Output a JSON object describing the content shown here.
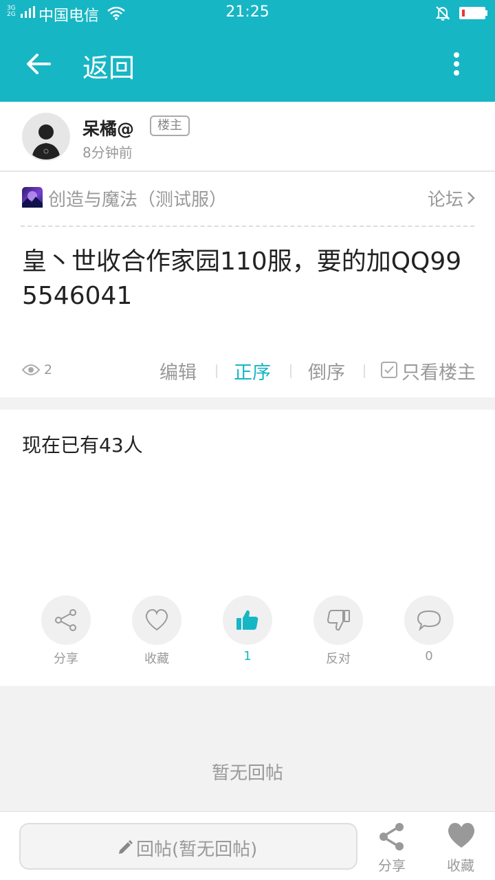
{
  "status_bar": {
    "net_top": "3G",
    "net_bottom": "2G",
    "carrier": "中国电信",
    "time": "21:25",
    "battery_level": 0.12
  },
  "app_bar": {
    "back_label": "返回"
  },
  "post": {
    "author": "呆橘@",
    "owner_badge": "楼主",
    "time_ago": "8分钟前",
    "forum_name": "创造与魔法（测试服）",
    "forum_link": "论坛",
    "title": "皇丶世收合作家园110服，要的加QQ995546041",
    "views": "2",
    "actions": {
      "edit": "编辑",
      "asc": "正序",
      "desc": "倒序",
      "owner_only": "只看楼主"
    },
    "content": "现在已有43人"
  },
  "reactions": {
    "share": "分享",
    "favorite": "收藏",
    "like_count": "1",
    "oppose": "反对",
    "comment_count": "0"
  },
  "replies": {
    "empty_text": "暂无回帖"
  },
  "bottom_bar": {
    "reply_label": "回帖(暂无回帖)",
    "share_label": "分享",
    "favorite_label": "收藏"
  },
  "colors": {
    "accent": "#17b6c4",
    "text_primary": "#222222",
    "text_secondary": "#999999",
    "background": "#f2f2f2"
  }
}
